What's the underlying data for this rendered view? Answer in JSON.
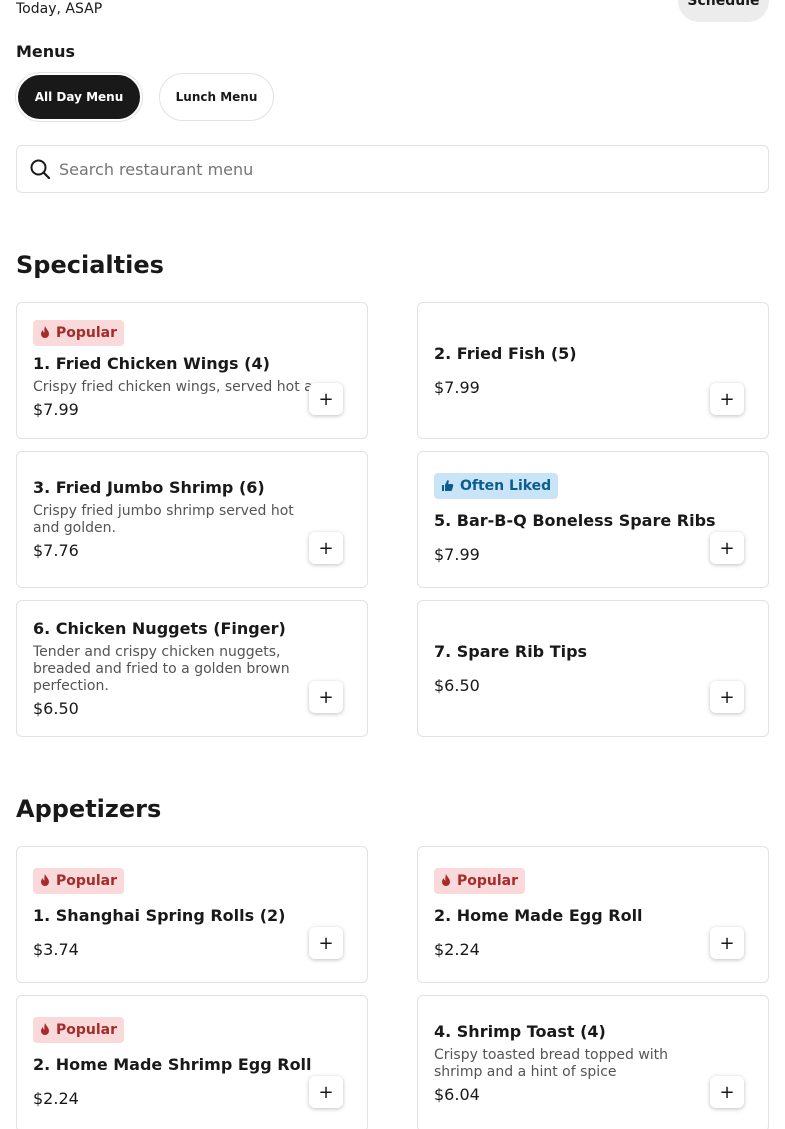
{
  "header": {
    "delivery_time": "Today, ASAP",
    "schedule_label": "Schedule",
    "menus_label": "Menus",
    "menu_tabs": [
      "All Day Menu",
      "Lunch Menu"
    ]
  },
  "search": {
    "placeholder": "Search restaurant menu",
    "value": ""
  },
  "sections": [
    {
      "title": "Specialties",
      "items": [
        {
          "badge": "Popular",
          "badge_icon": "flame-icon",
          "name": "1. Fried Chicken Wings (4)",
          "desc": "Crispy fried chicken wings, served hot a",
          "price": "$7.99"
        },
        {
          "badge": "",
          "name": "2. Fried Fish (5)",
          "desc": "",
          "price": "$7.99"
        },
        {
          "badge": "",
          "name": "3. Fried Jumbo Shrimp (6)",
          "desc": "Crispy fried jumbo shrimp served hot and golden.",
          "price": "$7.76"
        },
        {
          "badge": "Often Liked",
          "badge_icon": "thumbs-up-icon",
          "name": "5. Bar-B-Q Boneless Spare Ribs",
          "desc": "",
          "price": "$7.99"
        },
        {
          "badge": "",
          "name": "6. Chicken Nuggets (Finger)",
          "desc": "Tender and crispy chicken nuggets, breaded and fried to a golden brown perfection.",
          "price": "$6.50"
        },
        {
          "badge": "",
          "name": "7. Spare Rib Tips",
          "desc": "",
          "price": "$6.50"
        }
      ]
    },
    {
      "title": "Appetizers",
      "items": [
        {
          "badge": "Popular",
          "badge_icon": "flame-icon",
          "name": "1. Shanghai Spring Rolls (2)",
          "desc": "",
          "price": "$3.74"
        },
        {
          "badge": "Popular",
          "badge_icon": "flame-icon",
          "name": "2. Home Made Egg Roll",
          "desc": "",
          "price": "$2.24"
        },
        {
          "badge": "Popular",
          "badge_icon": "flame-icon",
          "name": "2. Home Made Shrimp Egg Roll",
          "desc": "",
          "price": "$2.24"
        },
        {
          "badge": "",
          "name": "4. Shrimp Toast (4)",
          "desc": "Crispy toasted bread topped with shrimp and a hint of spice",
          "price": "$6.04"
        }
      ]
    }
  ],
  "add_button_label": "+",
  "colors": {
    "popular_bg": "#f9d9d9",
    "popular_text": "#a62b2b",
    "liked_bg": "#c9e4f6",
    "liked_text": "#0b5d8f",
    "active_tab": "#191919"
  }
}
